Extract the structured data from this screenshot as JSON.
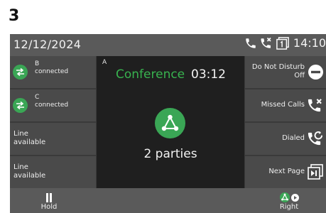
{
  "figure_number": "3",
  "statusbar": {
    "date": "12/12/2024",
    "time": "14:10",
    "icons": [
      "handset-icon",
      "missed-call-icon",
      "voicemail-icon"
    ]
  },
  "line_keys": [
    {
      "name": "B",
      "status": "connected",
      "icon": "conference-member-icon",
      "color": "#3aa655"
    },
    {
      "name": "C",
      "status": "connected",
      "icon": "conference-member-icon",
      "color": "#3aa655"
    },
    {
      "label_line1": "Line",
      "label_line2": "available"
    },
    {
      "label_line1": "Line",
      "label_line2": "available"
    }
  ],
  "center": {
    "position": "A",
    "title": "Conference",
    "timer": "03:12",
    "icon": "conference-icon",
    "parties": "2 parties",
    "accent": "#38b34f"
  },
  "right_keys": [
    {
      "line1": "Do Not Disturb",
      "line2": "Off",
      "icon": "do-not-disturb-icon"
    },
    {
      "line1": "Missed Calls",
      "icon": "missed-calls-icon"
    },
    {
      "line1": "Dialed",
      "icon": "dialed-icon"
    },
    {
      "line1": "Next Page",
      "icon": "next-page-icon"
    }
  ],
  "softkeys": [
    {
      "label": "Hold",
      "icon": "pause-icon"
    },
    {
      "label": "Right",
      "icon": "conference-right-icon"
    }
  ]
}
